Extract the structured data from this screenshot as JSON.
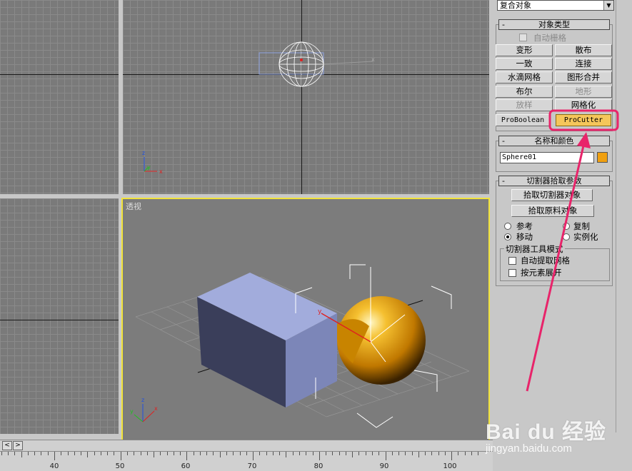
{
  "viewports": {
    "perspective_label": "透视"
  },
  "panel": {
    "category_dropdown": "复合对象",
    "object_type": {
      "title": "对象类型",
      "auto_grid": "自动栅格",
      "buttons": [
        "变形",
        "散布",
        "一致",
        "连接",
        "水滴网格",
        "图形合并",
        "布尔",
        "地形",
        "放样",
        "网格化",
        "ProBoolean",
        "ProCutter"
      ],
      "disabled": [
        "地形",
        "放样"
      ],
      "active": "ProCutter"
    },
    "name_color": {
      "title": "名称和颜色",
      "name_value": "Sphere01",
      "color": "#f0a010"
    },
    "cutter_pick": {
      "title": "切割器拾取参数",
      "pick_cutter": "拾取切割器对象",
      "pick_stock": "拾取原料对象",
      "radio_ref": "参考",
      "radio_copy": "复制",
      "radio_move": "移动",
      "radio_instance": "实例化",
      "selected_radio": "移动"
    },
    "cutter_tool_mode": {
      "title": "切割器工具模式",
      "auto_extract": "自动提取网格",
      "explode_by_element": "按元素展开"
    }
  },
  "ruler": {
    "labels": [
      "40",
      "50",
      "60",
      "70",
      "80",
      "90",
      "100"
    ]
  },
  "watermark": {
    "brand": "Bai du 经验",
    "url": "jingyan.baidu.com"
  },
  "colors": {
    "highlight": "#e8246a",
    "active_viewport_border": "#f2e33a",
    "sphere": "#f0a010",
    "box": "#8c96c8"
  }
}
